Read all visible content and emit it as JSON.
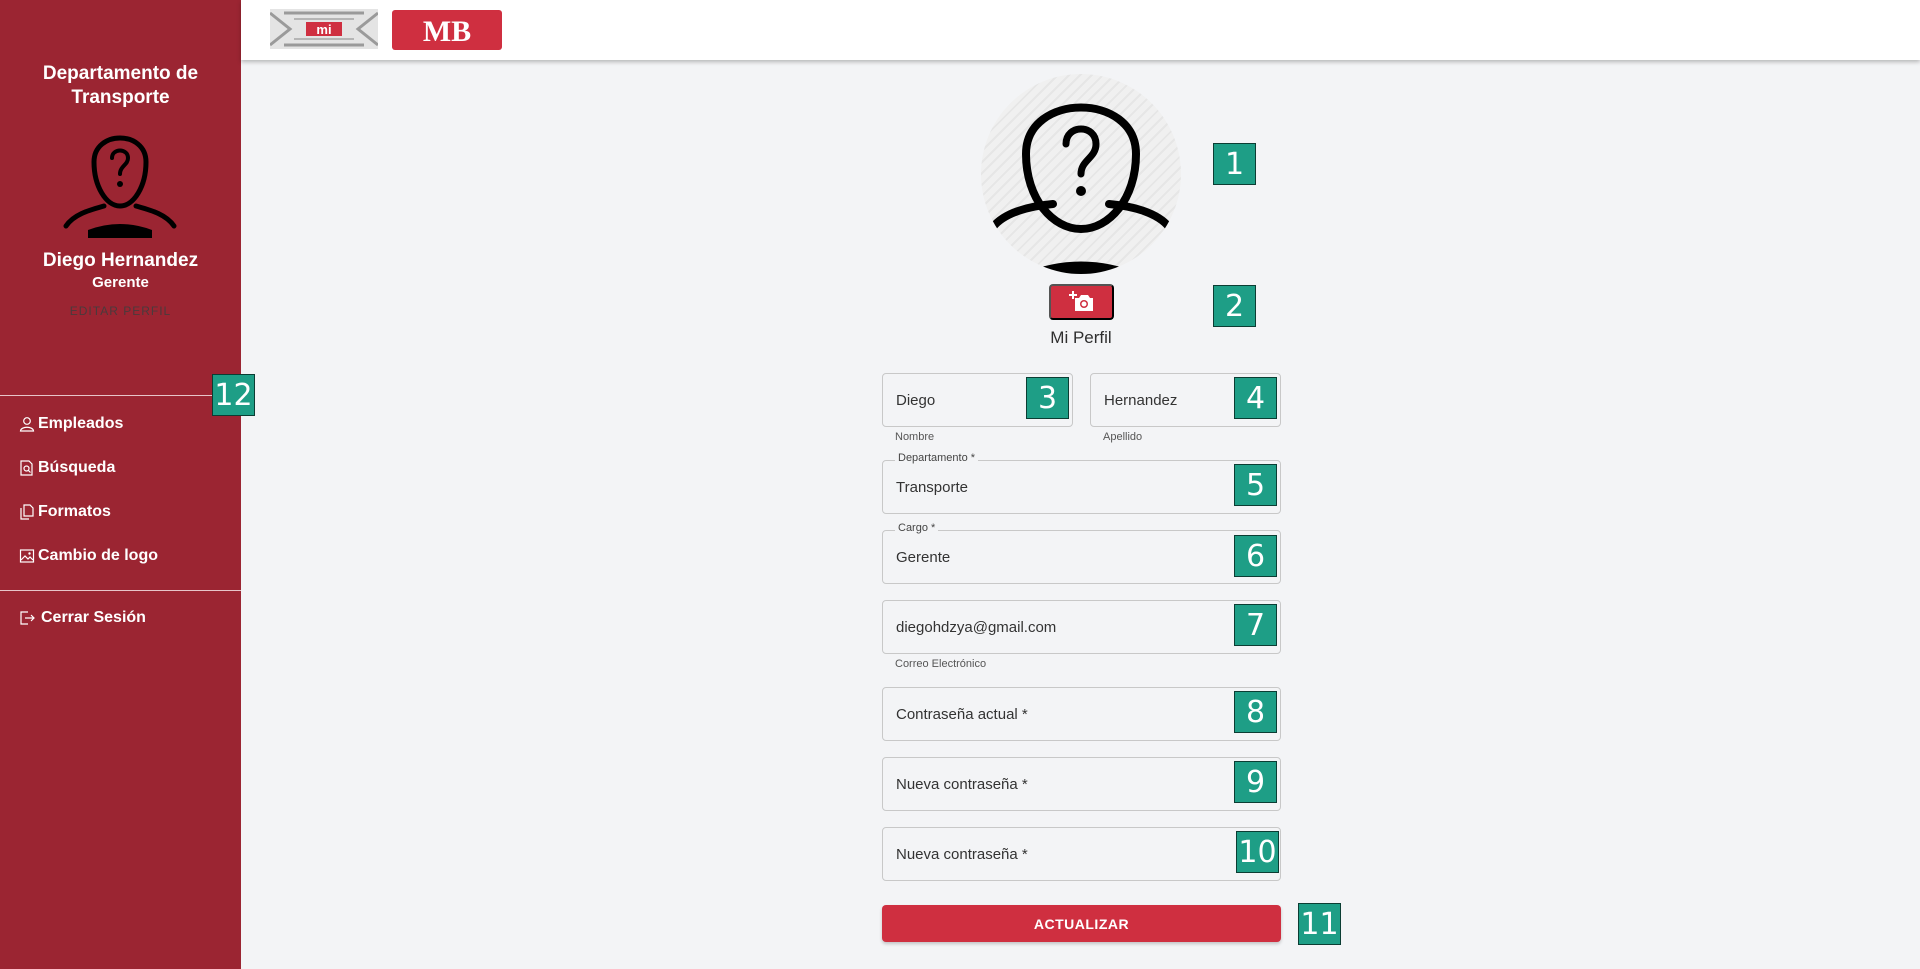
{
  "sidebar": {
    "department_title": "Departamento de Transporte",
    "user_name": "Diego Hernandez",
    "user_role": "Gerente",
    "edit_profile": "EDITAR PERFIL",
    "nav": [
      {
        "label": "Empleados",
        "icon": "user-icon"
      },
      {
        "label": "Búsqueda",
        "icon": "document-search-icon"
      },
      {
        "label": "Formatos",
        "icon": "documents-icon"
      },
      {
        "label": "Cambio de logo",
        "icon": "image-icon"
      }
    ],
    "logout": {
      "label": "Cerrar Sesión",
      "icon": "logout-icon"
    }
  },
  "header": {
    "logo_left_text": "mi",
    "logo_right_text": "MB"
  },
  "profile": {
    "title": "Mi Perfil",
    "camera_icon": "add-photo-icon"
  },
  "form": {
    "first_name": {
      "value": "Diego",
      "helper": "Nombre"
    },
    "last_name": {
      "value": "Hernandez",
      "helper": "Apellido"
    },
    "department": {
      "label": "Departamento *",
      "value": "Transporte"
    },
    "position": {
      "label": "Cargo *",
      "value": "Gerente"
    },
    "email": {
      "value": "diegohdzya@gmail.com",
      "helper": "Correo Electrónico"
    },
    "current_password": {
      "placeholder": "Contraseña actual *"
    },
    "new_password": {
      "placeholder": "Nueva contraseña *"
    },
    "confirm_password": {
      "placeholder": "Nueva contraseña *"
    },
    "submit_label": "ACTUALIZAR"
  },
  "badges": [
    "1",
    "2",
    "3",
    "4",
    "5",
    "6",
    "7",
    "8",
    "9",
    "10",
    "11",
    "12"
  ],
  "colors": {
    "sidebar": "#9b2532",
    "accent": "#cf2f40",
    "badge": "#1e9e86"
  }
}
